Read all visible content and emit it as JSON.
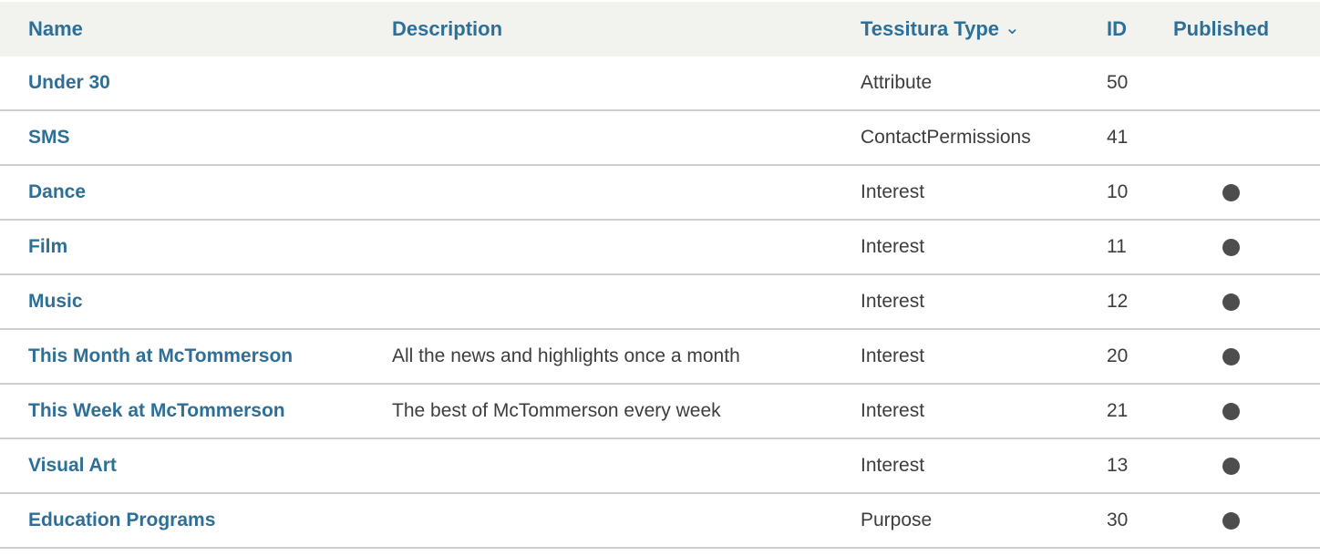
{
  "table": {
    "headers": {
      "name": "Name",
      "description": "Description",
      "type": "Tessitura Type",
      "type_sort_icon": "chevron-down-icon",
      "id": "ID",
      "published": "Published"
    },
    "rows": [
      {
        "name": "Under 30",
        "description": "",
        "type": "Attribute",
        "id": "50",
        "published": false
      },
      {
        "name": "SMS",
        "description": "",
        "type": "ContactPermissions",
        "id": "41",
        "published": false
      },
      {
        "name": "Dance",
        "description": "",
        "type": "Interest",
        "id": "10",
        "published": true
      },
      {
        "name": "Film",
        "description": "",
        "type": "Interest",
        "id": "11",
        "published": true
      },
      {
        "name": "Music",
        "description": "",
        "type": "Interest",
        "id": "12",
        "published": true
      },
      {
        "name": "This Month at McTommerson",
        "description": "All the news and highlights once a month",
        "type": "Interest",
        "id": "20",
        "published": true
      },
      {
        "name": "This Week at McTommerson",
        "description": "The best of McTommerson every week",
        "type": "Interest",
        "id": "21",
        "published": true
      },
      {
        "name": "Visual Art",
        "description": "",
        "type": "Interest",
        "id": "13",
        "published": true
      },
      {
        "name": "Education Programs",
        "description": "",
        "type": "Purpose",
        "id": "30",
        "published": true
      }
    ]
  },
  "colors": {
    "link": "#2e6f97",
    "header_bg": "#f2f2ef",
    "dot": "#4d4d4d"
  }
}
